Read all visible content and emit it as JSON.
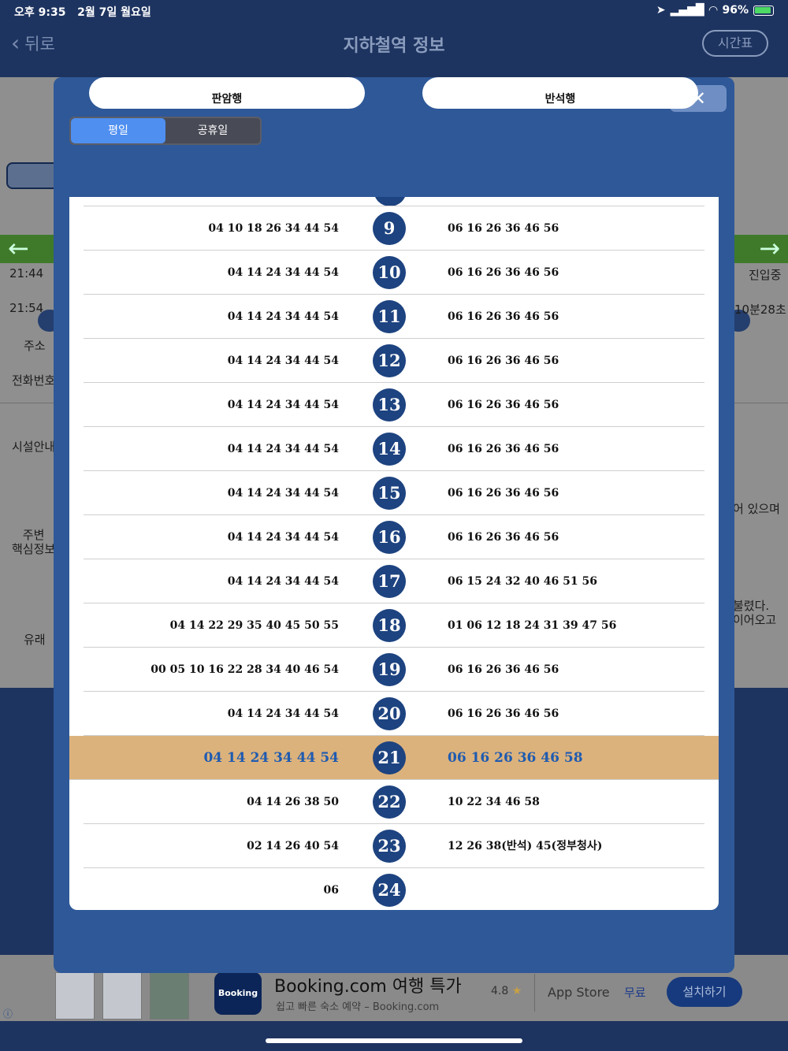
{
  "status_bar": {
    "time": "오후 9:35",
    "date": "2월 7일 월요일",
    "battery": "96%"
  },
  "nav": {
    "back_label": "뒤로",
    "title": "지하철역 정보",
    "timetable_label": "시간표"
  },
  "background": {
    "times_left": [
      "21:44",
      "21:54"
    ],
    "status_right": [
      "진입중",
      "10분28초"
    ],
    "labels": [
      "주소",
      "전화번호",
      "시설안내",
      "주변\n핵심정보",
      "유래"
    ],
    "snippets": [
      "어 있으며",
      "불렸다.",
      "이어오고"
    ]
  },
  "modal": {
    "close_label": "✕",
    "tabs": [
      {
        "label": "평일",
        "active": true
      },
      {
        "label": "공휴일",
        "active": false
      }
    ],
    "direction_left": "판암행",
    "direction_right": "반석행",
    "rows": [
      {
        "hour": "9",
        "left": "04 10 18 26 34 44 54",
        "right": "06 16 26 36 46 56",
        "highlight": false
      },
      {
        "hour": "10",
        "left": "04 14 24 34 44 54",
        "right": "06 16 26 36 46 56",
        "highlight": false
      },
      {
        "hour": "11",
        "left": "04 14 24 34 44 54",
        "right": "06 16 26 36 46 56",
        "highlight": false
      },
      {
        "hour": "12",
        "left": "04 14 24 34 44 54",
        "right": "06 16 26 36 46 56",
        "highlight": false
      },
      {
        "hour": "13",
        "left": "04 14 24 34 44 54",
        "right": "06 16 26 36 46 56",
        "highlight": false
      },
      {
        "hour": "14",
        "left": "04 14 24 34 44 54",
        "right": "06 16 26 36 46 56",
        "highlight": false
      },
      {
        "hour": "15",
        "left": "04 14 24 34 44 54",
        "right": "06 16 26 36 46 56",
        "highlight": false
      },
      {
        "hour": "16",
        "left": "04 14 24 34 44 54",
        "right": "06 16 26 36 46 56",
        "highlight": false
      },
      {
        "hour": "17",
        "left": "04 14 24 34 44 54",
        "right": "06 15 24 32 40 46 51 56",
        "highlight": false
      },
      {
        "hour": "18",
        "left": "04 14 22 29 35 40 45 50 55",
        "right": "01 06 12 18 24 31 39 47 56",
        "highlight": false
      },
      {
        "hour": "19",
        "left": "00 05 10 16 22 28 34 40 46 54",
        "right": "06 16 26 36 46 56",
        "highlight": false
      },
      {
        "hour": "20",
        "left": "04 14 24 34 44 54",
        "right": "06 16 26 36 46 56",
        "highlight": false
      },
      {
        "hour": "21",
        "left": "04 14 24 34 44 54",
        "right": "06 16 26 36 46 58",
        "highlight": true
      },
      {
        "hour": "22",
        "left": "04 14 26 38 50",
        "right": "10 22 34 46 58",
        "highlight": false
      },
      {
        "hour": "23",
        "left": "02 14 26 40 54",
        "right": "12 26 38(반석) 45(정부청사)",
        "highlight": false
      },
      {
        "hour": "24",
        "left": "06",
        "right": "",
        "highlight": false
      }
    ]
  },
  "ad": {
    "logo_text": "Booking",
    "title": "Booking.com 여행 특가",
    "subtitle": "쉽고 빠른 숙소 예약 – Booking.com",
    "rating": "4.8",
    "store": "App Store",
    "price": "무료",
    "install_label": "설치하기"
  }
}
